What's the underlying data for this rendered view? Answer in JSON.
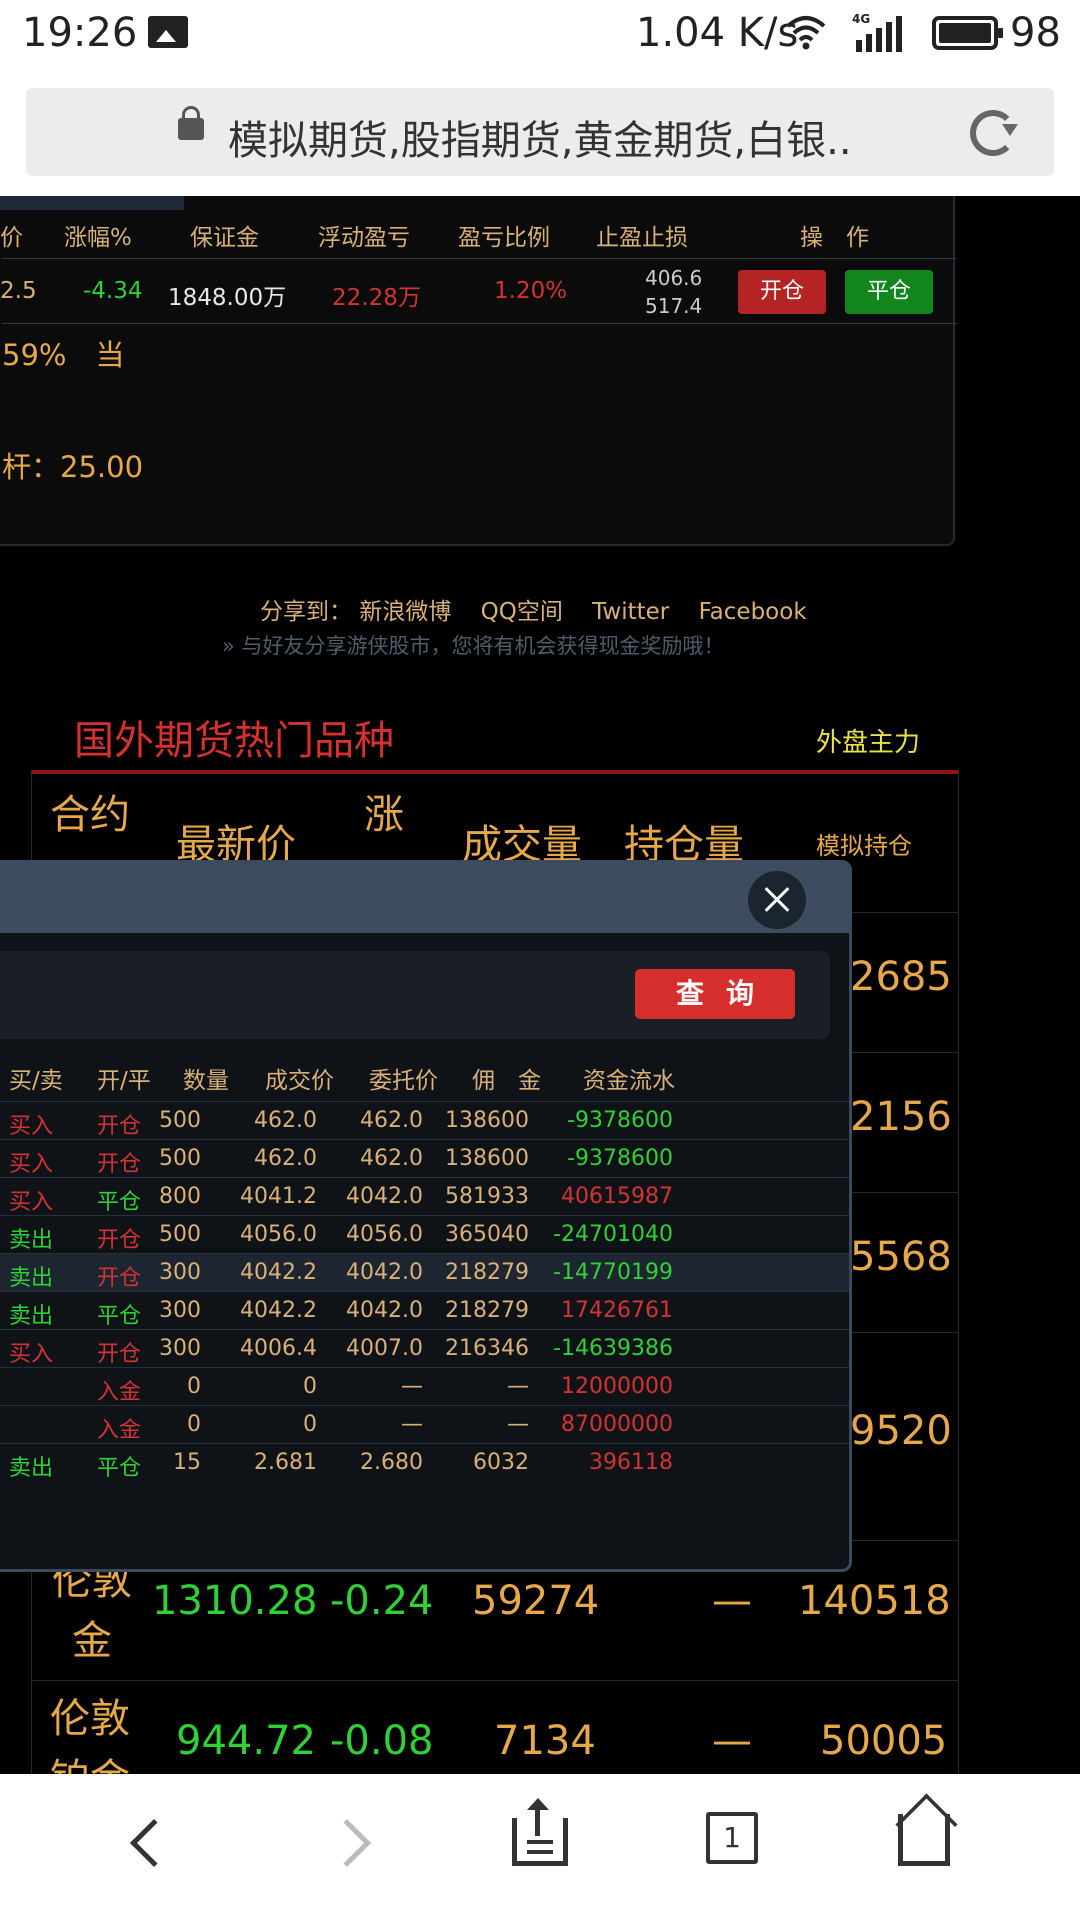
{
  "status_bar": {
    "time": "19:26",
    "net_speed": "1.04 K/s",
    "network": "4G",
    "battery": "98"
  },
  "url_bar": {
    "title": "模拟期货,股指期货,黄金期货,白银.."
  },
  "position_panel": {
    "headers": [
      "价",
      "涨幅%",
      "保证金",
      "浮动盈亏",
      "盈亏比例",
      "止盈止损",
      "操　作"
    ],
    "row": {
      "price": "2.5",
      "change": "-4.34",
      "margin": "1848.00万",
      "pnl": "22.28万",
      "pnl_ratio": "1.20%",
      "stop_profit": "406.6",
      "stop_loss": "517.4"
    },
    "open_label": "开仓",
    "close_label": "平仓",
    "info1": "59%　当",
    "info2": "杆：25.00"
  },
  "share": {
    "label": "分享到：",
    "links": [
      "新浪微博",
      "QQ空间",
      "Twitter",
      "Facebook"
    ],
    "tip": "» 与好友分享游侠股市，您将有机会获得现金奖励哦！"
  },
  "hot": {
    "title": "国外期货热门品种",
    "main_label": "外盘主力",
    "headers": [
      "合约",
      "最新价",
      "涨",
      "成交量",
      "持仓量",
      "模拟持仓"
    ],
    "partial_values": [
      "2685",
      "2156",
      "5568",
      "9520"
    ],
    "rows": [
      {
        "name_top": "伦敦",
        "name_bottom": "金",
        "price": "1310.28",
        "change": "-0.24",
        "volume": "59274",
        "oi": "—",
        "sim": "140518"
      },
      {
        "name_top": "伦敦",
        "name_bottom": "铂金",
        "price": "944.72",
        "change": "-0.08",
        "volume": "7134",
        "oi": "—",
        "sim": "50005"
      }
    ]
  },
  "modal": {
    "query_label": "查询",
    "headers": [
      "买/卖",
      "开/平",
      "数量",
      "成交价",
      "委托价",
      "佣　金",
      "资金流水"
    ],
    "rows": [
      {
        "side": "买入",
        "oc": "开仓",
        "qty": "500",
        "deal": "462.0",
        "order": "462.0",
        "fee": "138600",
        "flow": "-9378600"
      },
      {
        "side": "买入",
        "oc": "开仓",
        "qty": "500",
        "deal": "462.0",
        "order": "462.0",
        "fee": "138600",
        "flow": "-9378600"
      },
      {
        "side": "买入",
        "oc": "平仓",
        "qty": "800",
        "deal": "4041.2",
        "order": "4042.0",
        "fee": "581933",
        "flow": "40615987"
      },
      {
        "side": "卖出",
        "oc": "开仓",
        "qty": "500",
        "deal": "4056.0",
        "order": "4056.0",
        "fee": "365040",
        "flow": "-24701040"
      },
      {
        "side": "卖出",
        "oc": "开仓",
        "qty": "300",
        "deal": "4042.2",
        "order": "4042.0",
        "fee": "218279",
        "flow": "-14770199"
      },
      {
        "side": "卖出",
        "oc": "平仓",
        "qty": "300",
        "deal": "4042.2",
        "order": "4042.0",
        "fee": "218279",
        "flow": "17426761"
      },
      {
        "side": "买入",
        "oc": "开仓",
        "qty": "300",
        "deal": "4006.4",
        "order": "4007.0",
        "fee": "216346",
        "flow": "-14639386"
      },
      {
        "side": "",
        "oc": "入金",
        "qty": "0",
        "deal": "0",
        "order": "—",
        "fee": "—",
        "flow": "12000000"
      },
      {
        "side": "",
        "oc": "入金",
        "qty": "0",
        "deal": "0",
        "order": "—",
        "fee": "—",
        "flow": "87000000"
      },
      {
        "side": "卖出",
        "oc": "平仓",
        "qty": "15",
        "deal": "2.681",
        "order": "2.680",
        "fee": "6032",
        "flow": "396118"
      }
    ]
  },
  "nav": {
    "tab_count": "1"
  }
}
